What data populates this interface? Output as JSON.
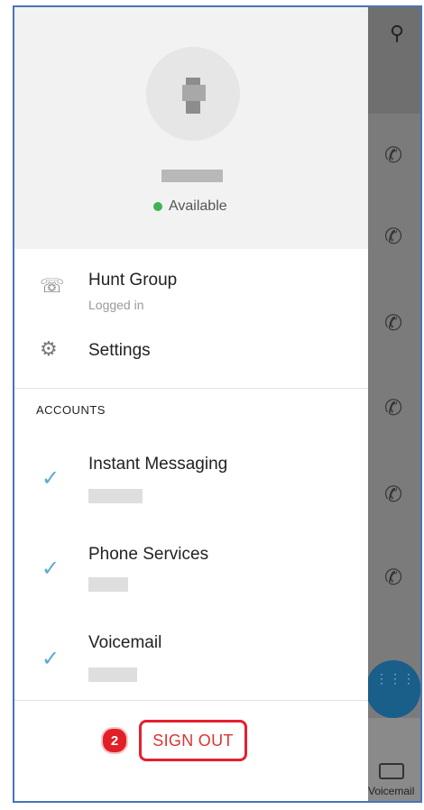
{
  "profile": {
    "status": "Available",
    "status_color": "#3fb34f"
  },
  "menu": [
    {
      "title": "Hunt Group",
      "subtitle": "Logged in",
      "icon": "hunt-group-phone-icon"
    },
    {
      "title": "Settings",
      "icon": "gear-icon"
    }
  ],
  "accounts": {
    "header": "ACCOUNTS",
    "items": [
      {
        "title": "Instant Messaging",
        "icon": "checkmark-icon"
      },
      {
        "title": "Phone Services",
        "icon": "checkmark-icon"
      },
      {
        "title": "Voicemail",
        "icon": "checkmark-icon"
      }
    ]
  },
  "signout": {
    "label": "SIGN OUT",
    "badge": "2",
    "highlight_color": "#e5202e"
  },
  "background_app": {
    "bottom_nav_label": "Voicemail"
  }
}
